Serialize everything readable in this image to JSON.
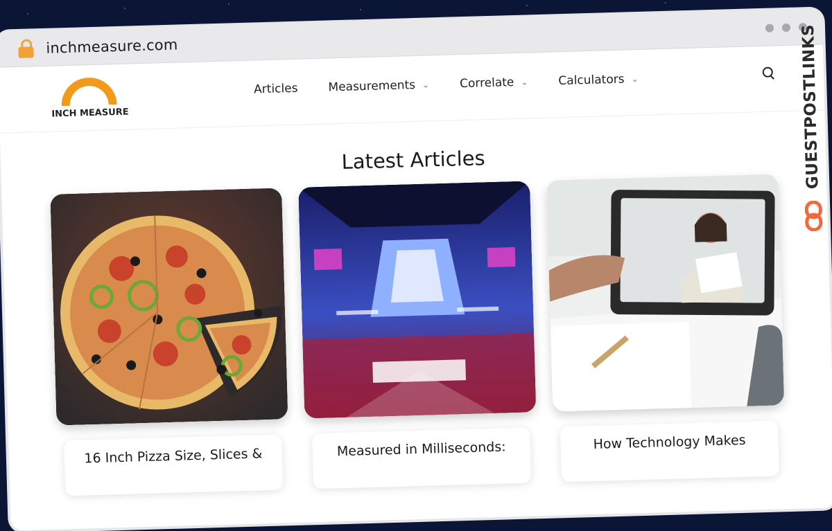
{
  "browser": {
    "url": "inchmeasure.com"
  },
  "site": {
    "logo_text": "INCH MEASURE",
    "nav": [
      {
        "label": "Articles",
        "has_dropdown": false
      },
      {
        "label": "Measurements",
        "has_dropdown": true
      },
      {
        "label": "Correlate",
        "has_dropdown": true
      },
      {
        "label": "Calculators",
        "has_dropdown": true
      }
    ]
  },
  "section": {
    "title": "Latest Articles"
  },
  "articles": [
    {
      "title": "16 Inch Pizza Size, Slices &",
      "image": "pizza"
    },
    {
      "title": "Measured in Milliseconds:",
      "image": "esports-arena"
    },
    {
      "title": "How Technology Makes",
      "image": "video-call-tablet"
    }
  ],
  "watermark": {
    "text": "GUESTPOSTLINKS"
  },
  "colors": {
    "accent": "#f29a1d",
    "background": "#0b1535",
    "watermark_mark": "#f06a3b"
  }
}
